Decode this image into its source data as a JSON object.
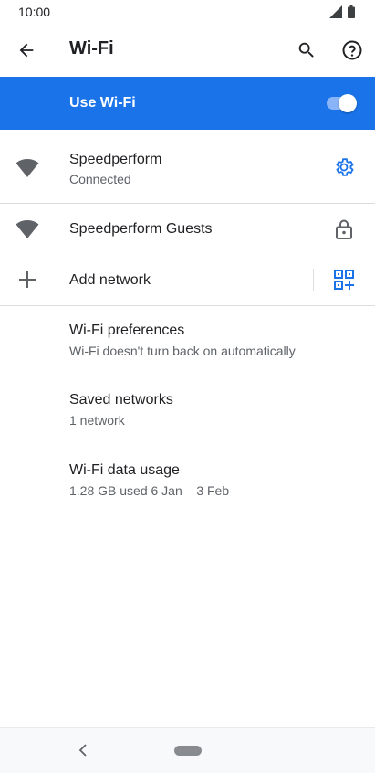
{
  "status_bar": {
    "time": "10:00"
  },
  "app_bar": {
    "title": "Wi-Fi"
  },
  "master_switch": {
    "label": "Use Wi-Fi",
    "on": true
  },
  "networks": [
    {
      "name": "Speedperform",
      "status": "Connected",
      "trailing_icon": "gear-icon"
    },
    {
      "name": "Speedperform Guests",
      "trailing_icon": "lock-icon"
    }
  ],
  "add_network": {
    "label": "Add network",
    "trailing_icon": "qr-code-icon"
  },
  "settings": [
    {
      "title": "Wi-Fi preferences",
      "subtitle": "Wi-Fi doesn't turn back on automatically"
    },
    {
      "title": "Saved networks",
      "subtitle": "1 network"
    },
    {
      "title": "Wi-Fi data usage",
      "subtitle": "1.28 GB used 6 Jan – 3 Feb"
    }
  ],
  "colors": {
    "accent": "#1a73e8",
    "toggle_track": "#8ab4f8",
    "divider": "#dadce0"
  }
}
